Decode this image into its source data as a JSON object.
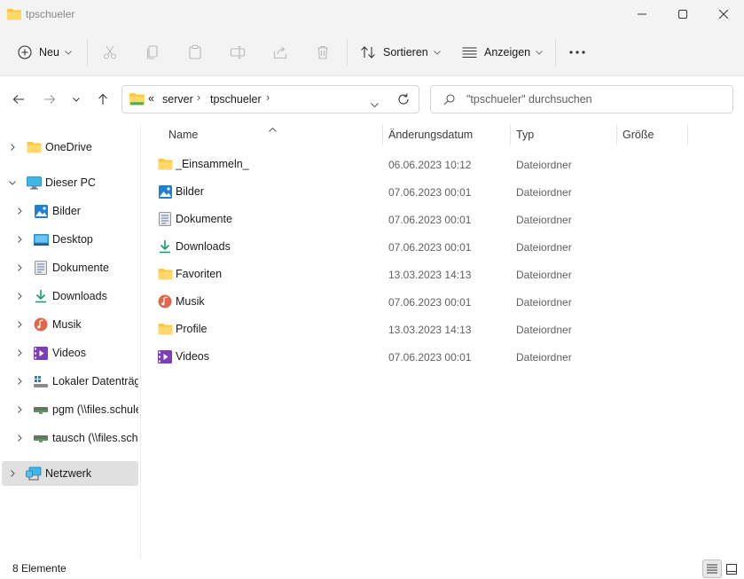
{
  "window": {
    "title": "tpschueler"
  },
  "toolbar": {
    "new_label": "Neu",
    "sort_label": "Sortieren",
    "view_label": "Anzeigen"
  },
  "address": {
    "overflow": "«",
    "segments": [
      "server",
      "tpschueler"
    ]
  },
  "search": {
    "placeholder": "\"tpschueler\" durchsuchen"
  },
  "sidebar": {
    "items": [
      {
        "label": "OneDrive",
        "icon": "onedrive-folder-icon"
      },
      {
        "label": "Dieser PC",
        "icon": "computer-icon"
      },
      {
        "label": "Bilder",
        "icon": "pictures-icon"
      },
      {
        "label": "Desktop",
        "icon": "desktop-icon"
      },
      {
        "label": "Dokumente",
        "icon": "documents-icon"
      },
      {
        "label": "Downloads",
        "icon": "downloads-icon"
      },
      {
        "label": "Musik",
        "icon": "music-icon"
      },
      {
        "label": "Videos",
        "icon": "videos-icon"
      },
      {
        "label": "Lokaler Datenträger",
        "icon": "drive-icon"
      },
      {
        "label": "pgm (\\\\files.schule",
        "icon": "network-drive-icon"
      },
      {
        "label": "tausch (\\\\files.schu",
        "icon": "network-drive-icon"
      },
      {
        "label": "Netzwerk",
        "icon": "network-icon"
      }
    ]
  },
  "columns": {
    "name": "Name",
    "date": "Änderungsdatum",
    "type": "Typ",
    "size": "Größe"
  },
  "files": [
    {
      "name": "_Einsammeln_",
      "date": "06.06.2023 10:12",
      "type": "Dateiordner",
      "icon": "folder-icon"
    },
    {
      "name": "Bilder",
      "date": "07.06.2023 00:01",
      "type": "Dateiordner",
      "icon": "pictures-icon"
    },
    {
      "name": "Dokumente",
      "date": "07.06.2023 00:01",
      "type": "Dateiordner",
      "icon": "documents-icon"
    },
    {
      "name": "Downloads",
      "date": "07.06.2023 00:01",
      "type": "Dateiordner",
      "icon": "downloads-icon"
    },
    {
      "name": "Favoriten",
      "date": "13.03.2023 14:13",
      "type": "Dateiordner",
      "icon": "folder-icon"
    },
    {
      "name": "Musik",
      "date": "07.06.2023 00:01",
      "type": "Dateiordner",
      "icon": "music-icon"
    },
    {
      "name": "Profile",
      "date": "13.03.2023 14:13",
      "type": "Dateiordner",
      "icon": "folder-icon"
    },
    {
      "name": "Videos",
      "date": "07.06.2023 00:01",
      "type": "Dateiordner",
      "icon": "videos-icon"
    }
  ],
  "status": {
    "count": "8 Elemente"
  },
  "colors": {
    "folder": "#f8c846",
    "accent": "#0067c0",
    "selected": "#e0e0e0"
  }
}
